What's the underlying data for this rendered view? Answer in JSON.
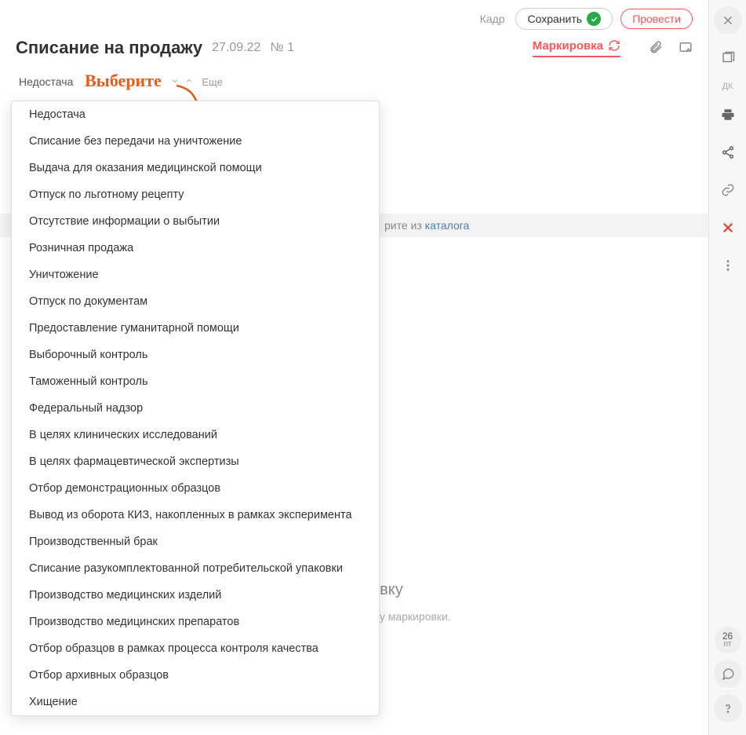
{
  "topbar": {
    "kadr": "Кадр",
    "save": "Сохранить",
    "process": "Провести"
  },
  "header": {
    "title": "Списание на продажу",
    "date": "27.09.22",
    "num_prefix": "№",
    "num": "1",
    "tab_marking": "Маркировка"
  },
  "filter": {
    "selected": "Недостача",
    "more": "Еще"
  },
  "annotation": "Выберите",
  "dropdown_items": [
    "Недостача",
    "Списание без передачи на уничтожение",
    "Выдача для оказания медицинской помощи",
    "Отпуск по льготному рецепту",
    "Отсутствие информации о выбытии",
    "Розничная продажа",
    "Уничтожение",
    "Отпуск по документам",
    "Предоставление гуманитарной помощи",
    "Выборочный контроль",
    "Таможенный контроль",
    "Федеральный надзор",
    "В целях клинических исследований",
    "В целях фармацевтической экспертизы",
    "Отбор демонстрационных образцов",
    "Вывод из оборота КИЗ, накопленных в рамках эксперимента",
    "Производственный брак",
    "Списание разукомплектованной потребительской упаковки",
    "Производство медицинских изделий",
    "Производство медицинских препаратов",
    "Отбор образцов в рамках процесса контроля качества",
    "Отбор архивных образцов",
    "Хищение"
  ],
  "bgbar": {
    "prefix": "рите из ",
    "link": "каталога"
  },
  "center": {
    "heading_tail": "е маркировку",
    "sub_tail": " будут заполнены по коду маркировки."
  },
  "rail": {
    "dk": "ДК",
    "date_num": "26",
    "date_day": "пт"
  }
}
